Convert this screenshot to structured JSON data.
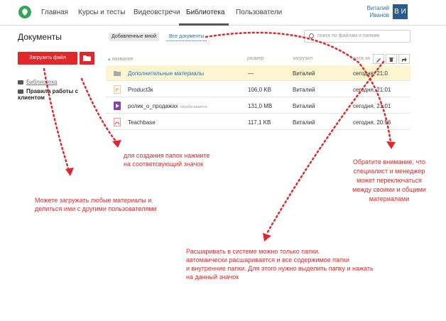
{
  "header": {
    "nav": [
      "Главная",
      "Курсы и тесты",
      "Видеовстречи",
      "Библиотека",
      "Пользователи"
    ],
    "active_nav": "Библиотека",
    "user_first": "Виталий",
    "user_last": "Иванов",
    "avatar_initials": "В И"
  },
  "left": {
    "title": "Документы",
    "upload_label": "Загрузить файл",
    "tree": [
      "Библиотека",
      "Правила работы с клиентом"
    ]
  },
  "filters": {
    "added_by_me": "Добавленные мной",
    "all_docs": "Все документы",
    "search_placeholder": "поиск по файлам и папкам"
  },
  "table": {
    "columns": [
      "название",
      "размер",
      "загрузил",
      "дата за"
    ],
    "rows": [
      {
        "name": "Дополнительные материалы",
        "size": "—",
        "uploader": "Виталий",
        "date": "сегодня, 21:0",
        "note": ""
      },
      {
        "name": "Product3к",
        "size": "106,0 KB",
        "uploader": "Виталий",
        "date": "сегодня, 21:01",
        "note": ""
      },
      {
        "name": "ролик_о_продажах",
        "size": "131,0 MB",
        "uploader": "Виталий",
        "date": "сегодня, 21:01",
        "note": "обрабатывается"
      },
      {
        "name": "Teachbase",
        "size": "117,1 KB",
        "uploader": "Виталий",
        "date": "сегодня, 20:56",
        "note": ""
      }
    ]
  },
  "annotations": {
    "folder_tip_1": "для создания папок нажмите",
    "folder_tip_2": "на соответсвующий значок",
    "upload_tip_1": "Можете загружать любые материалы и",
    "upload_tip_2": "делиться ими с другими пользователями",
    "switch_tip_1": "Обратите внимание, что",
    "switch_tip_2": "специалист и менеджер",
    "switch_tip_3": "может переключаться",
    "switch_tip_4": "между своими и общими",
    "switch_tip_5": "материалами",
    "share_tip_1": "Расшаривать в системе можно только папки.",
    "share_tip_2": "автомаически расшаривается и все содержимое папки",
    "share_tip_3": "и внутренние папки. Для этого нужно выделить папку и нажать",
    "share_tip_4": "на данный значок"
  },
  "colors": {
    "accent": "#e0272b",
    "link": "#2a6fb8",
    "highlight": "#fbf6cf"
  }
}
